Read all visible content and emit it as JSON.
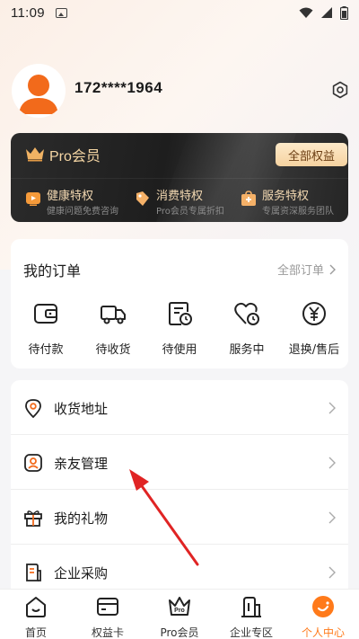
{
  "status_bar": {
    "time": "11:09"
  },
  "profile": {
    "phone": "172****1964"
  },
  "pro_card": {
    "title": "Pro会员",
    "all_rights_button": "全部权益",
    "benefits": [
      {
        "title": "健康特权",
        "subtitle": "健康问题免费咨询"
      },
      {
        "title": "消费特权",
        "subtitle": "Pro会员专属折扣"
      },
      {
        "title": "服务特权",
        "subtitle": "专属资深服务团队"
      }
    ]
  },
  "orders": {
    "title": "我的订单",
    "all_link": "全部订单",
    "items": [
      {
        "label": "待付款",
        "icon": "wallet-icon"
      },
      {
        "label": "待收货",
        "icon": "truck-icon"
      },
      {
        "label": "待使用",
        "icon": "ticket-clock-icon"
      },
      {
        "label": "服务中",
        "icon": "heart-clock-icon"
      },
      {
        "label": "退换/售后",
        "icon": "yen-refund-icon"
      }
    ]
  },
  "menu": {
    "items": [
      {
        "label": "收货地址",
        "icon": "location-pin-icon"
      },
      {
        "label": "亲友管理",
        "icon": "family-user-icon"
      },
      {
        "label": "我的礼物",
        "icon": "gift-icon"
      },
      {
        "label": "企业采购",
        "icon": "enterprise-doc-icon"
      }
    ]
  },
  "bottom_nav": {
    "items": [
      {
        "label": "首页",
        "icon": "home-icon",
        "active": false
      },
      {
        "label": "权益卡",
        "icon": "card-icon",
        "active": false
      },
      {
        "label": "Pro会员",
        "icon": "pro-crown-icon",
        "active": false
      },
      {
        "label": "企业专区",
        "icon": "enterprise-icon",
        "active": false
      },
      {
        "label": "个人中心",
        "icon": "profile-icon",
        "active": true
      }
    ]
  },
  "colors": {
    "accent": "#ff7a1a",
    "gold": "#f5d6a4",
    "annotation_arrow": "#e02424"
  }
}
